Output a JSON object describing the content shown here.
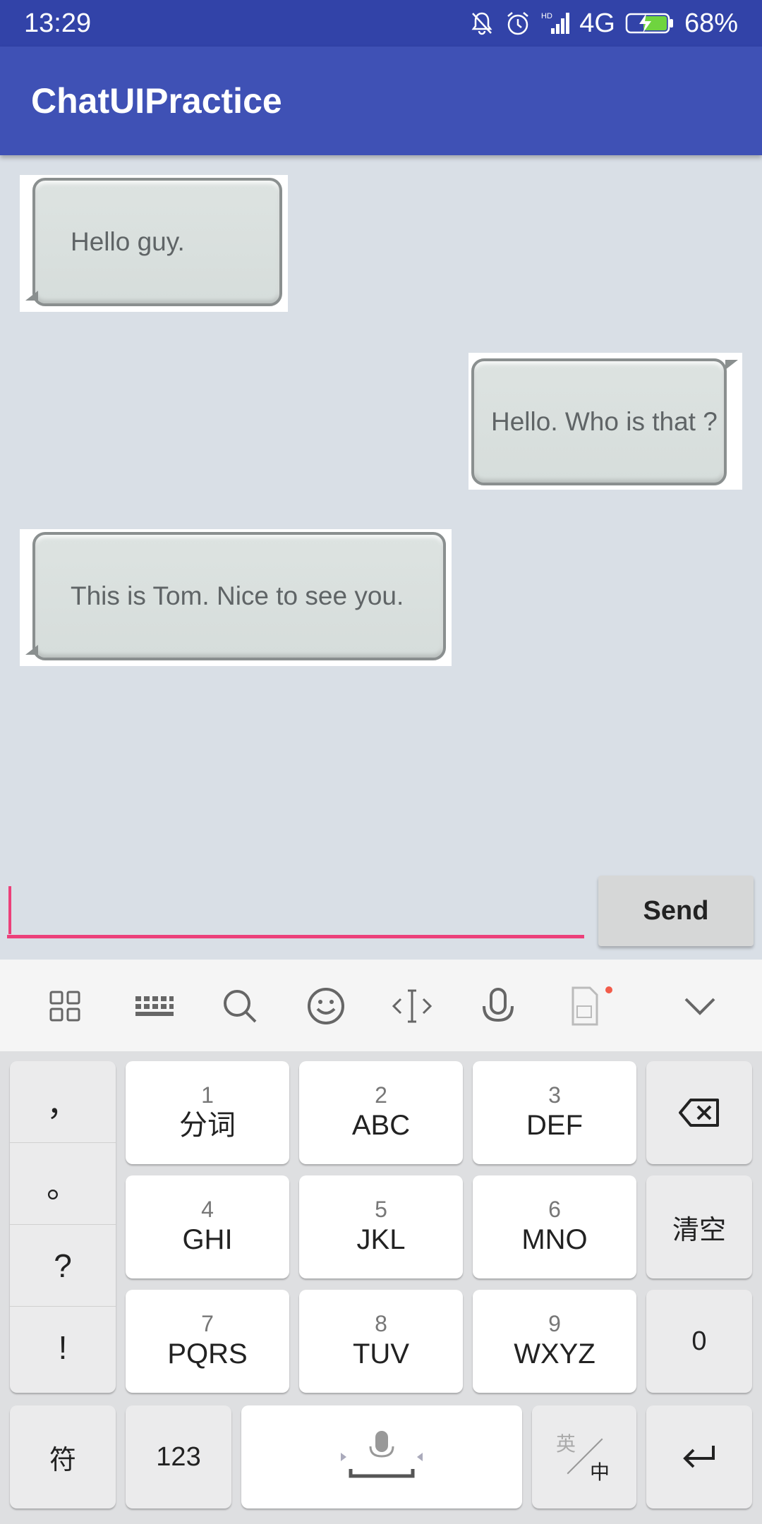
{
  "status_bar": {
    "time": "13:29",
    "network": "4G",
    "battery": "68%",
    "hd_label": "HD"
  },
  "app_bar": {
    "title": "ChatUIPractice"
  },
  "messages": [
    {
      "side": "left",
      "text": "Hello guy."
    },
    {
      "side": "right",
      "text": "Hello. Who is that ?"
    },
    {
      "side": "left",
      "text": "This is Tom. Nice to see you."
    }
  ],
  "input": {
    "value": "",
    "placeholder": ""
  },
  "send_button": {
    "label": "Send"
  },
  "keyboard_toolbar": {
    "icons": [
      "grid-icon",
      "keyboard-icon",
      "search-icon",
      "emoji-icon",
      "cursor-move-icon",
      "microphone-icon",
      "sim-card-icon",
      "chevron-down-icon"
    ]
  },
  "keyboard": {
    "punctuation": [
      "，",
      "。",
      "?",
      "!"
    ],
    "keys": [
      {
        "num": "1",
        "letters": "分词"
      },
      {
        "num": "2",
        "letters": "ABC"
      },
      {
        "num": "3",
        "letters": "DEF"
      },
      {
        "num": "4",
        "letters": "GHI"
      },
      {
        "num": "5",
        "letters": "JKL"
      },
      {
        "num": "6",
        "letters": "MNO"
      },
      {
        "num": "7",
        "letters": "PQRS"
      },
      {
        "num": "8",
        "letters": "TUV"
      },
      {
        "num": "9",
        "letters": "WXYZ"
      }
    ],
    "clear_label": "清空",
    "zero_label": "0",
    "symbol_label": "符",
    "numbers_label": "123",
    "lang_en": "英",
    "lang_zh": "中"
  },
  "colors": {
    "status_bar": "#3243a8",
    "app_bar": "#3f51b5",
    "accent": "#ec407a",
    "chat_bg": "#d9dfe6"
  }
}
